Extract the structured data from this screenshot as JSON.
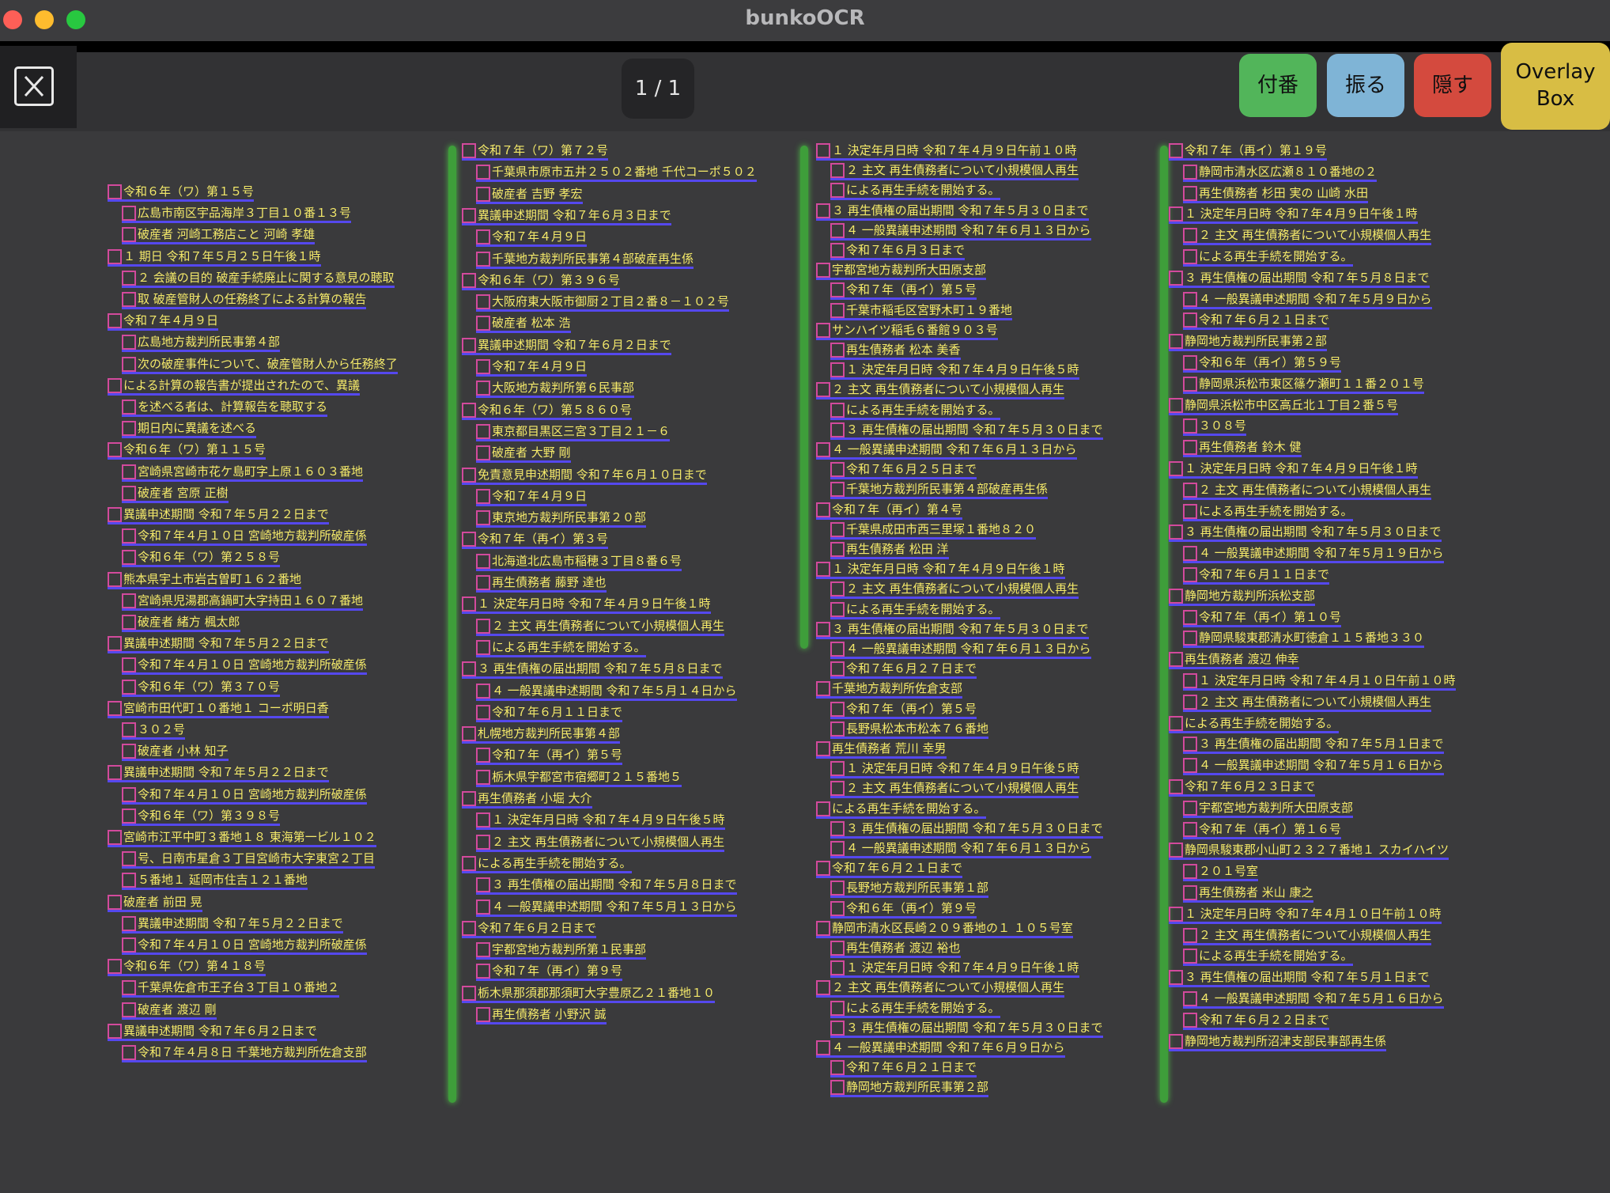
{
  "window": {
    "title": "bunkoOCR"
  },
  "toolbar": {
    "page_indicator": "1 / 1",
    "buttons": {
      "number": "付番",
      "shake": "振る",
      "hide": "隠す",
      "overlay": "Overlay Box"
    }
  },
  "icons": {
    "close": "close-square-icon"
  },
  "colors": {
    "ocr_text": "#f5ea6a",
    "line_underline": "#5548ee",
    "char_box": "#d24a9c",
    "column_separator": "#4fbf48"
  },
  "document": {
    "columns": [
      [
        "令和６年（ワ）第１５号",
        "広島市南区宇品海岸３丁目１０番１３号",
        "破産者 河崎工務店こと 河崎 孝雄",
        "１ 期日 令和７年５月２５日午後１時",
        "２ 会議の目的 破産手続廃止に関する意見の聴取",
        "取 破産管財人の任務終了による計算の報告",
        "令和７年４月９日",
        "広島地方裁判所民事第４部",
        "次の破産事件について、破産管財人から任務終了",
        "による計算の報告書が提出されたので、異議",
        "を述べる者は、計算報告を聴取する",
        "期日内に異議を述べる",
        "令和６年（ワ）第１１５号",
        "宮崎県宮崎市花ケ島町字上原１６０３番地",
        "破産者 宮原 正樹",
        "異議申述期間 令和７年５月２２日まで",
        "令和７年４月１０日 宮崎地方裁判所破産係",
        "令和６年（ワ）第２５８号",
        "熊本県宇土市岩古曽町１６２番地",
        "宮崎県児湯郡高鍋町大字持田１６０７番地",
        "破産者 緒方 楓太郎",
        "異議申述期間 令和７年５月２２日まで",
        "令和７年４月１０日 宮崎地方裁判所破産係",
        "令和６年（ワ）第３７０号",
        "宮崎市田代町１０番地１ コーポ明日香",
        "３０２号",
        "破産者 小林 知子",
        "異議申述期間 令和７年５月２２日まで",
        "令和７年４月１０日 宮崎地方裁判所破産係",
        "令和６年（ワ）第３９８号",
        "宮崎市江平中町３番地１８ 東海第一ビル１０２",
        "号、日南市星倉３丁目宮崎市大字東宮２丁目",
        "５番地１ 延岡市住吉１２１番地",
        "破産者 前田 晃",
        "異議申述期間 令和７年５月２２日まで",
        "令和７年４月１０日 宮崎地方裁判所破産係",
        "令和６年（ワ）第４１８号",
        "千葉県佐倉市王子台３丁目１０番地２",
        "破産者 渡辺 剛",
        "異議申述期間 令和７年６月２日まで",
        "令和７年４月８日 千葉地方裁判所佐倉支部"
      ],
      [
        "令和７年（ワ）第７２号",
        "千葉県市原市五井２５０２番地 千代コーポ５０２",
        "破産者 吉野 孝宏",
        "異議申述期間 令和７年６月３日まで",
        "令和７年４月９日",
        "千葉地方裁判所民事第４部破産再生係",
        "令和６年（ワ）第３９６号",
        "大阪府東大阪市御厨２丁目２番８－１０２号",
        "破産者 松本 浩",
        "異議申述期間 令和７年６月２日まで",
        "令和７年４月９日",
        "大阪地方裁判所第６民事部",
        "令和６年（ワ）第５８６０号",
        "東京都目黒区三宮３丁目２１－６",
        "破産者 大野 剛",
        "免責意見申述期間 令和７年６月１０日まで",
        "令和７年４月９日",
        "東京地方裁判所民事第２０部",
        "令和７年（再イ）第３号",
        "北海道北広島市稲穂３丁目８番６号",
        "再生債務者 藤野 達也",
        "１ 決定年月日時 令和７年４月９日午後１時",
        "２ 主文 再生債務者について小規模個人再生",
        "による再生手続を開始する。",
        "３ 再生債権の届出期間 令和７年５月８日まで",
        "４ 一般異議申述期間 令和７年５月１４日から",
        "令和７年６月１１日まで",
        "札幌地方裁判所民事第４部",
        "令和７年（再イ）第５号",
        "栃木県宇都宮市宿郷町２１５番地５",
        "再生債務者 小堀 大介",
        "１ 決定年月日時 令和７年４月９日午後５時",
        "２ 主文 再生債務者について小規模個人再生",
        "による再生手続を開始する。",
        "３ 再生債権の届出期間 令和７年５月８日まで",
        "４ 一般異議申述期間 令和７年５月１３日から",
        "令和７年６月２日まで",
        "宇都宮地方裁判所第１民事部",
        "令和７年（再イ）第９号",
        "栃木県那須郡那須町大字豊原乙２１番地１０",
        "再生債務者 小野沢 誠"
      ],
      [
        "１ 決定年月日時 令和７年４月９日午前１０時",
        "２ 主文 再生債務者について小規模個人再生",
        "による再生手続を開始する。",
        "３ 再生債権の届出期間 令和７年５月３０日まで",
        "４ 一般異議申述期間 令和７年６月１３日から",
        "令和７年６月３日まで",
        "宇都宮地方裁判所大田原支部",
        "令和７年（再イ）第５号",
        "千葉市稲毛区宮野木町１９番地",
        "サンハイツ稲毛６番館９０３号",
        "再生債務者 松本 美香",
        "１ 決定年月日時 令和７年４月９日午後５時",
        "２ 主文 再生債務者について小規模個人再生",
        "による再生手続を開始する。",
        "３ 再生債権の届出期間 令和７年５月３０日まで",
        "４ 一般異議申述期間 令和７年６月１３日から",
        "令和７年６月２５日まで",
        "千葉地方裁判所民事第４部破産再生係",
        "令和７年（再イ）第４号",
        "千葉県成田市西三里塚１番地８２０",
        "再生債務者 松田 洋",
        "１ 決定年月日時 令和７年４月９日午後１時",
        "２ 主文 再生債務者について小規模個人再生",
        "による再生手続を開始する。",
        "３ 再生債権の届出期間 令和７年５月３０日まで",
        "４ 一般異議申述期間 令和７年６月１３日から",
        "令和７年６月２７日まで",
        "千葉地方裁判所佐倉支部",
        "令和７年（再イ）第５号",
        "長野県松本市松本７６番地",
        "再生債務者 荒川 幸男",
        "１ 決定年月日時 令和７年４月９日午後５時",
        "２ 主文 再生債務者について小規模個人再生",
        "による再生手続を開始する。",
        "３ 再生債権の届出期間 令和７年５月３０日まで",
        "４ 一般異議申述期間 令和７年６月１３日から",
        "令和７年６月２１日まで",
        "長野地方裁判所民事第１部",
        "令和６年（再イ）第９号",
        "静岡市清水区長崎２０９番地の１ １０５号室",
        "再生債務者 渡辺 裕也",
        "１ 決定年月日時 令和７年４月９日午後１時",
        "２ 主文 再生債務者について小規模個人再生",
        "による再生手続を開始する。",
        "３ 再生債権の届出期間 令和７年５月３０日まで",
        "４ 一般異議申述期間 令和７年６月９日から",
        "令和７年６月２１日まで",
        "静岡地方裁判所民事第２部"
      ],
      [
        "令和７年（再イ）第１９号",
        "静岡市清水区広瀬８１０番地の２",
        "再生債務者 杉田 実の 山崎 水田",
        "１ 決定年月日時 令和７年４月９日午後１時",
        "２ 主文 再生債務者について小規模個人再生",
        "による再生手続を開始する。",
        "３ 再生債権の届出期間 令和７年５月８日まで",
        "４ 一般異議申述期間 令和７年５月９日から",
        "令和７年６月２１日まで",
        "静岡地方裁判所民事第２部",
        "令和６年（再イ）第５９号",
        "静岡県浜松市東区篠ケ瀬町１１番２０１号",
        "静岡県浜松市中区高丘北１丁目２番５号",
        "３０８号",
        "再生債務者 鈴木 健",
        "１ 決定年月日時 令和７年４月９日午後１時",
        "２ 主文 再生債務者について小規模個人再生",
        "による再生手続を開始する。",
        "３ 再生債権の届出期間 令和７年５月３０日まで",
        "４ 一般異議申述期間 令和７年５月１９日から",
        "令和７年６月１１日まで",
        "静岡地方裁判所浜松支部",
        "令和７年（再イ）第１０号",
        "静岡県駿東郡清水町徳倉１１５番地３３０",
        "再生債務者 渡辺 伸幸",
        "１ 決定年月日時 令和７年４月１０日午前１０時",
        "２ 主文 再生債務者について小規模個人再生",
        "による再生手続を開始する。",
        "３ 再生債権の届出期間 令和７年５月１日まで",
        "４ 一般異議申述期間 令和７年５月１６日から",
        "令和７年６月２３日まで",
        "宇都宮地方裁判所大田原支部",
        "令和７年（再イ）第１６号",
        "静岡県駿東郡小山町２３２７番地１ スカイハイツ",
        "２０１号室",
        "再生債務者 米山 康之",
        "１ 決定年月日時 令和７年４月１０日午前１０時",
        "２ 主文 再生債務者について小規模個人再生",
        "による再生手続を開始する。",
        "３ 再生債権の届出期間 令和７年５月１日まで",
        "４ 一般異議申述期間 令和７年５月１６日から",
        "令和７年６月２２日まで",
        "静岡地方裁判所沼津支部民事部再生係"
      ]
    ]
  }
}
